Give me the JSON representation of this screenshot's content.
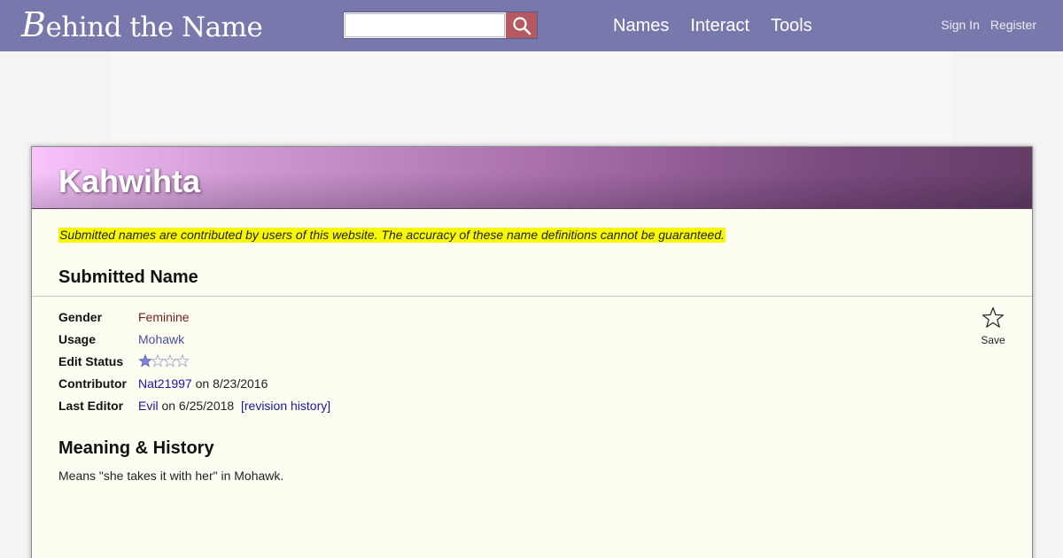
{
  "header": {
    "logo_first": "B",
    "logo_rest": "ehind the Name",
    "search_placeholder": "",
    "search_value": "",
    "nav": [
      {
        "label": "Names"
      },
      {
        "label": "Interact"
      },
      {
        "label": "Tools"
      }
    ],
    "sign_in": "Sign In",
    "register": "Register"
  },
  "card": {
    "name": "Kahwihta",
    "disclaimer": "Submitted names are contributed by users of this website. The accuracy of these name definitions cannot be guaranteed.",
    "section_title": "Submitted Name",
    "save_label": "Save",
    "fields": {
      "gender": {
        "label": "Gender",
        "value": "Feminine"
      },
      "usage": {
        "label": "Usage",
        "value": "Mohawk"
      },
      "edit_status": {
        "label": "Edit Status",
        "stars_filled": 1,
        "stars_total": 4
      },
      "contributor": {
        "label": "Contributor",
        "user": "Nat21997",
        "date_text": "on 8/23/2016"
      },
      "last_editor": {
        "label": "Last Editor",
        "user": "Evil",
        "date_text": "on 6/25/2018",
        "history_link": "[revision history]"
      }
    },
    "meaning_title": "Meaning & History",
    "meaning_text": "Means \"she takes it with her\" in Mohawk."
  },
  "colors": {
    "topbar": "#7978ac",
    "search_button": "#b55a62",
    "card_background": "#fdfdf1",
    "highlight": "#f8f800",
    "link": "#1c14a8",
    "gender_link": "#7a1c1c"
  }
}
